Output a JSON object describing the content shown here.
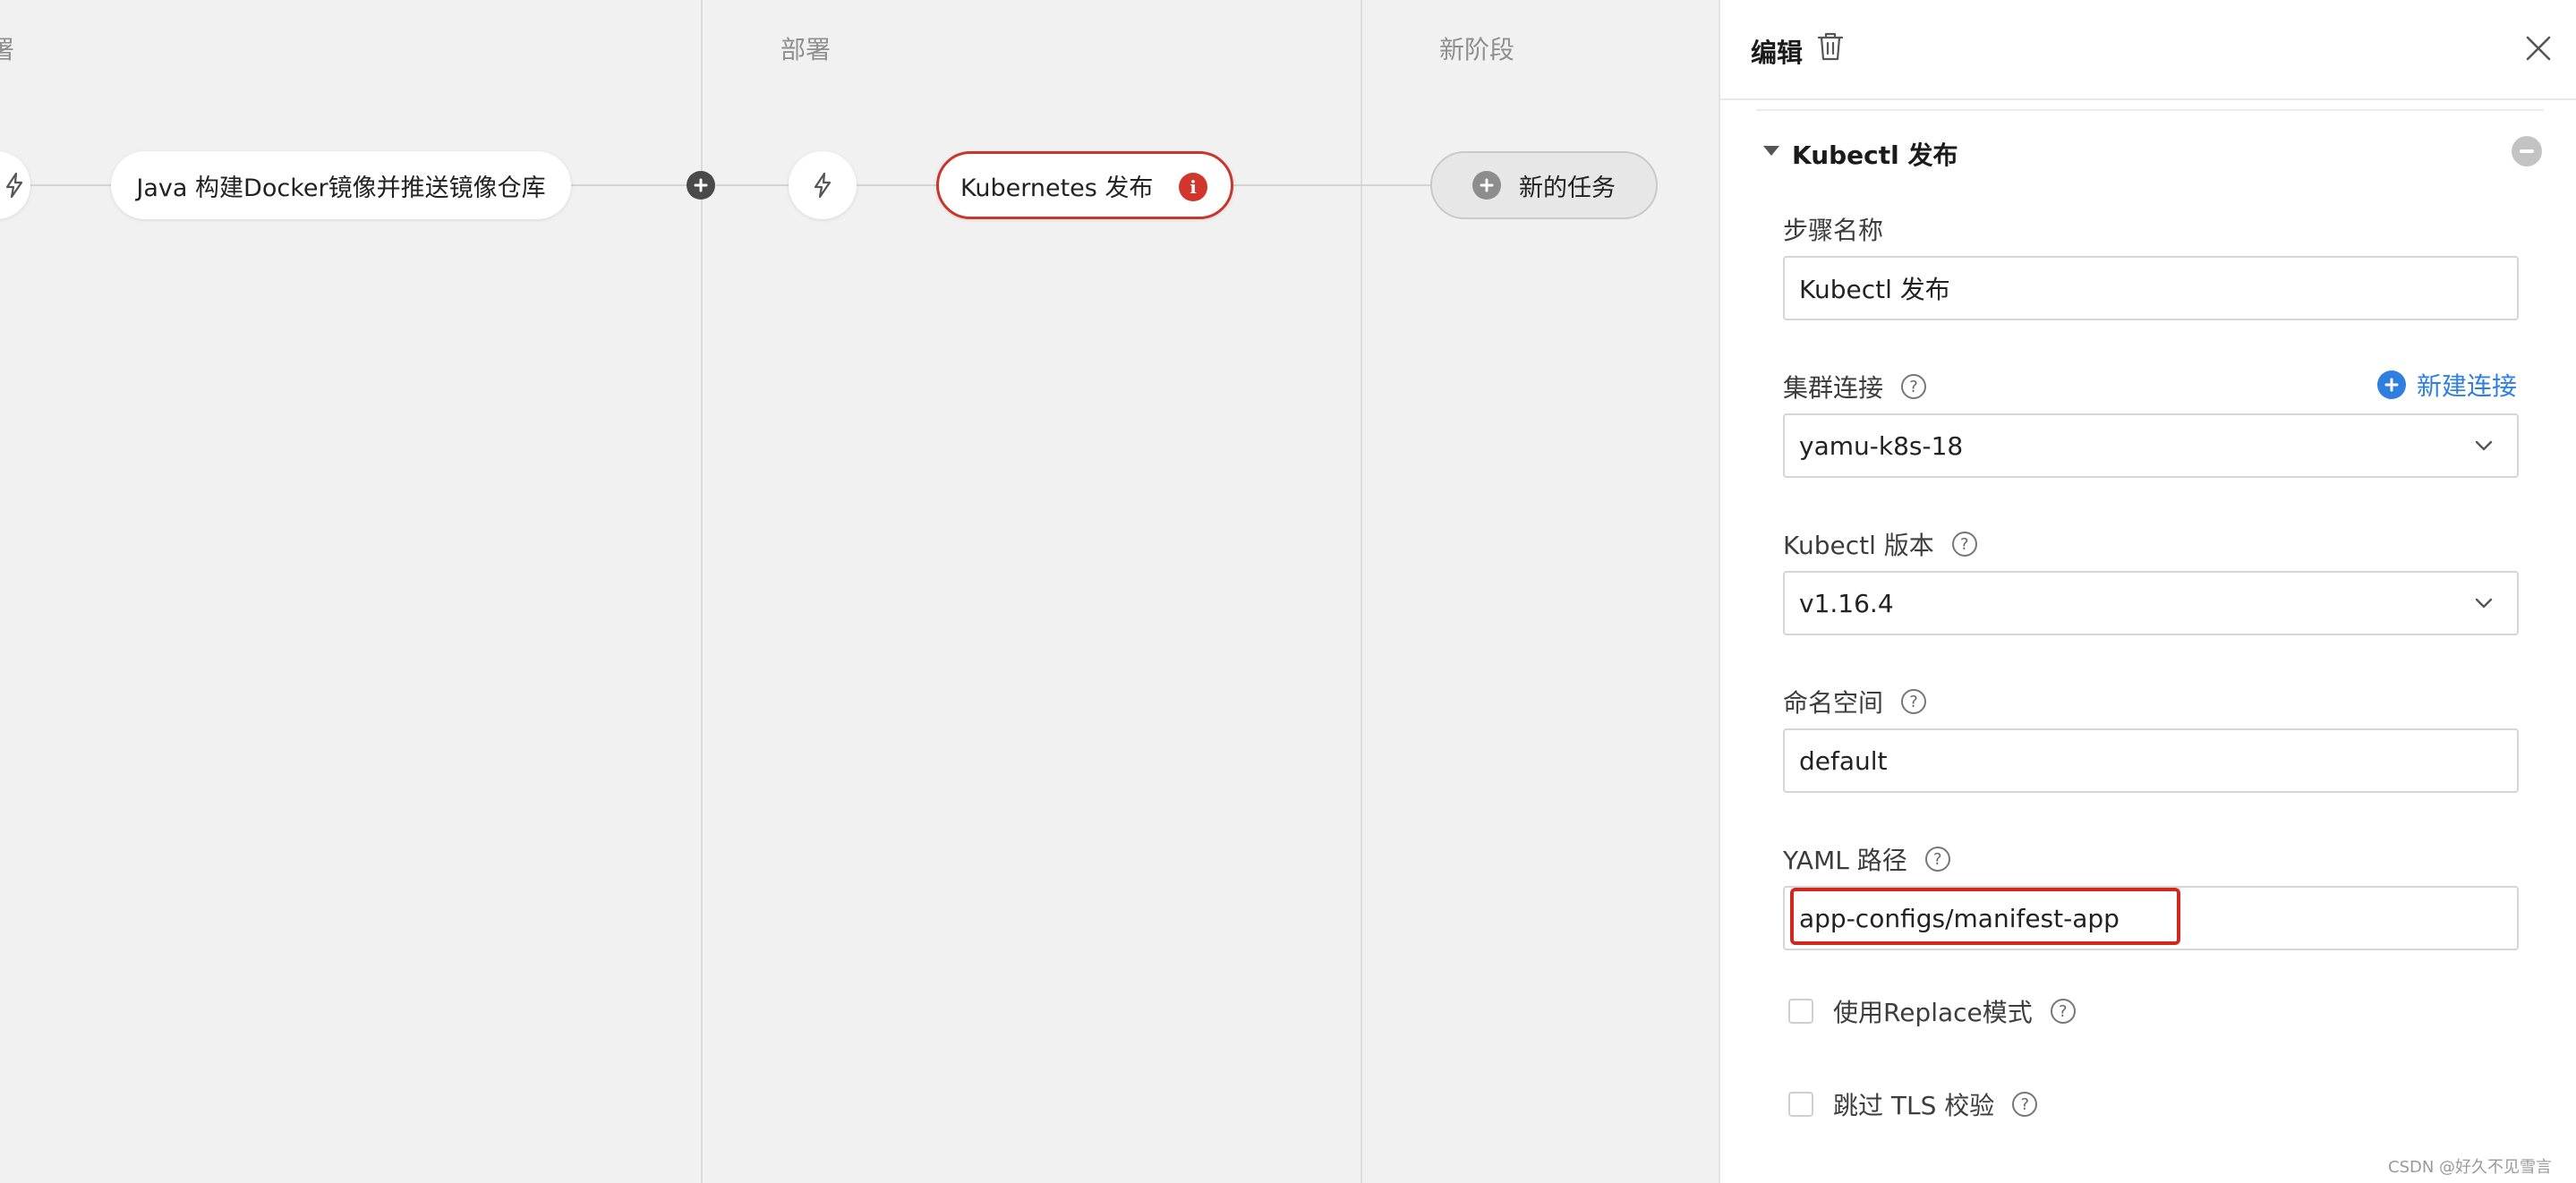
{
  "pipeline": {
    "stages": [
      {
        "title": "署"
      },
      {
        "title": "部署"
      },
      {
        "title": "新阶段"
      }
    ],
    "tasks": {
      "build": "Java 构建Docker镜像并推送镜像仓库",
      "deploy": "Kubernetes 发布",
      "new_task": "新的任务"
    },
    "icons": {
      "trigger": "lightning-icon",
      "error": "info-icon",
      "add": "plus-icon"
    },
    "error_badge": "i"
  },
  "panel": {
    "title": "编辑",
    "section_title": "Kubectl 发布",
    "fields": {
      "step_name": {
        "label": "步骤名称",
        "value": "Kubectl 发布"
      },
      "cluster": {
        "label": "集群连接",
        "value": "yamu-k8s-18",
        "action": "新建连接"
      },
      "kubectl_version": {
        "label": "Kubectl 版本",
        "value": "v1.16.4"
      },
      "namespace": {
        "label": "命名空间",
        "value": "default"
      },
      "yaml_path": {
        "label": "YAML 路径",
        "value": "app-configs/manifest-app"
      }
    },
    "options": {
      "replace_mode": {
        "label": "使用Replace模式",
        "checked": false
      },
      "skip_tls": {
        "label": "跳过 TLS 校验",
        "checked": false
      }
    },
    "help_glyph": "?"
  },
  "colors": {
    "error": "#d0362c",
    "link": "#2f7fe0",
    "highlight": "#d3271e"
  },
  "watermark": "CSDN @好久不见雪言"
}
